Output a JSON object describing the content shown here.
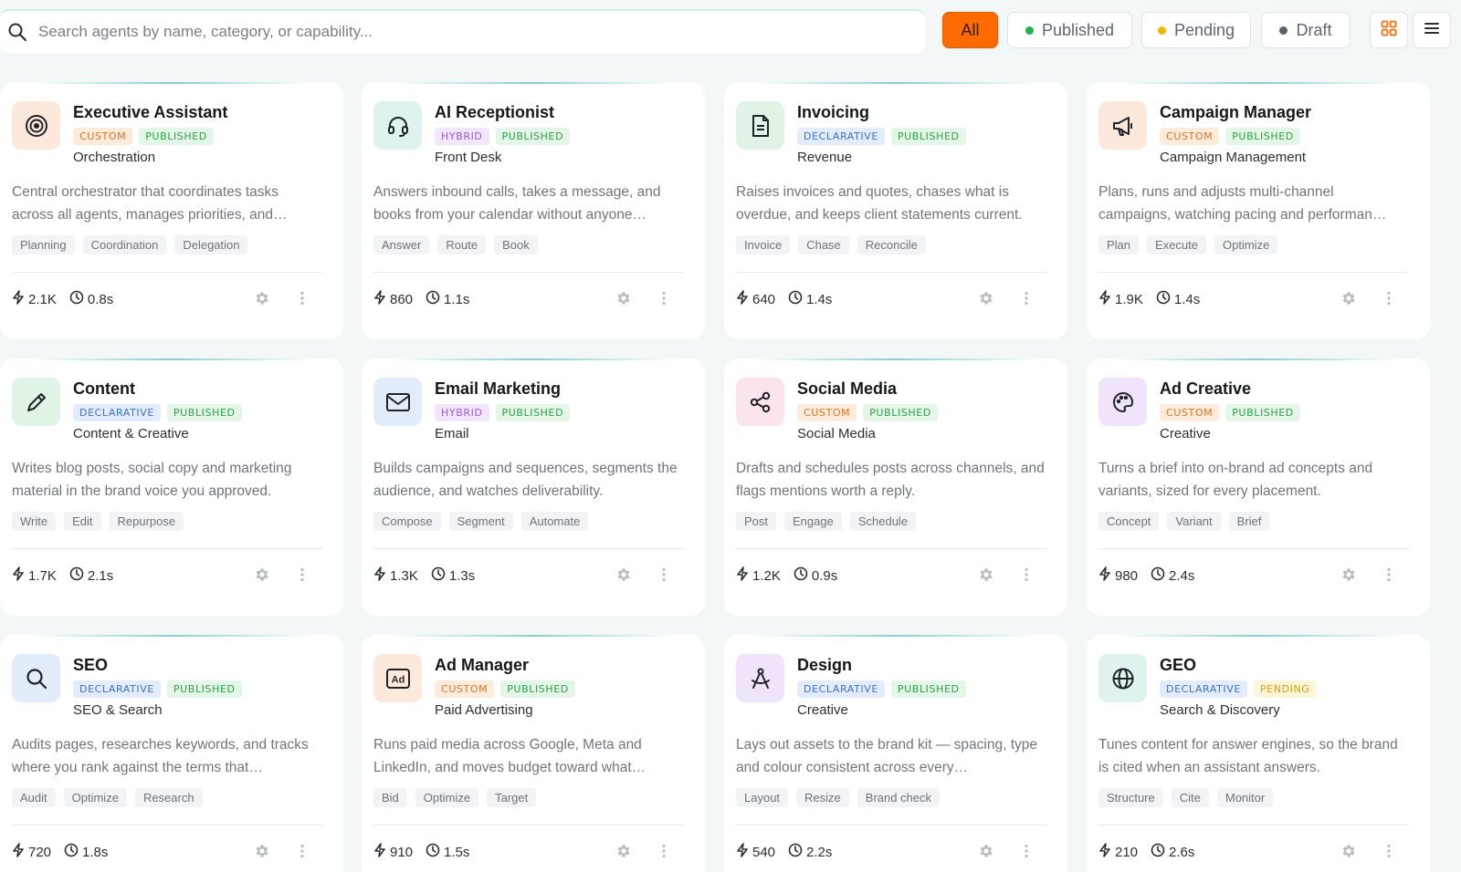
{
  "search": {
    "placeholder": "Search agents by name, category, or capability..."
  },
  "filters": [
    {
      "label": "All",
      "active": true
    },
    {
      "label": "Published",
      "dot": "#22b14c"
    },
    {
      "label": "Pending",
      "dot": "#f2b705"
    },
    {
      "label": "Draft",
      "dot": "#5b6168"
    }
  ],
  "colors": {
    "accent": "#ff6a00"
  },
  "cards": [
    {
      "title": "Executive Assistant",
      "type": "CUSTOM",
      "status": "PUBLISHED",
      "category": "Orchestration",
      "description": "Central orchestrator that coordinates tasks across all agents, manages priorities, and…",
      "tags": [
        "Planning",
        "Coordination",
        "Delegation"
      ],
      "runs": "2.1K",
      "latency": "0.8s",
      "icon": "target-icon",
      "icon_bg": "#fde9dc"
    },
    {
      "title": "AI Receptionist",
      "type": "HYBRID",
      "status": "PUBLISHED",
      "category": "Front Desk",
      "description": "Answers inbound calls, takes a message, and books from your calendar without anyone…",
      "tags": [
        "Answer",
        "Route",
        "Book"
      ],
      "runs": "860",
      "latency": "1.1s",
      "icon": "headset-icon",
      "icon_bg": "#def3f0"
    },
    {
      "title": "Invoicing",
      "type": "DECLARATIVE",
      "status": "PUBLISHED",
      "category": "Revenue",
      "description": "Raises invoices and quotes, chases what is overdue, and keeps client statements current.",
      "tags": [
        "Invoice",
        "Chase",
        "Reconcile"
      ],
      "runs": "640",
      "latency": "1.4s",
      "icon": "invoice-icon",
      "icon_bg": "#e0f3e5"
    },
    {
      "title": "Campaign Manager",
      "type": "CUSTOM",
      "status": "PUBLISHED",
      "category": "Campaign Management",
      "description": "Plans, runs and adjusts multi-channel campaigns, watching pacing and performan…",
      "tags": [
        "Plan",
        "Execute",
        "Optimize"
      ],
      "runs": "1.9K",
      "latency": "1.4s",
      "icon": "megaphone-icon",
      "icon_bg": "#fde9dc"
    },
    {
      "title": "Content",
      "type": "DECLARATIVE",
      "status": "PUBLISHED",
      "category": "Content & Creative",
      "description": "Writes blog posts, social copy and marketing material in the brand voice you approved.",
      "tags": [
        "Write",
        "Edit",
        "Repurpose"
      ],
      "runs": "1.7K",
      "latency": "2.1s",
      "icon": "pencil-icon",
      "icon_bg": "#e0f3e5"
    },
    {
      "title": "Email Marketing",
      "type": "HYBRID",
      "status": "PUBLISHED",
      "category": "Email",
      "description": "Builds campaigns and sequences, segments the audience, and watches deliverability.",
      "tags": [
        "Compose",
        "Segment",
        "Automate"
      ],
      "runs": "1.3K",
      "latency": "1.3s",
      "icon": "envelope-icon",
      "icon_bg": "#e3ecfb"
    },
    {
      "title": "Social Media",
      "type": "CUSTOM",
      "status": "PUBLISHED",
      "category": "Social Media",
      "description": "Drafts and schedules posts across channels, and flags mentions worth a reply.",
      "tags": [
        "Post",
        "Engage",
        "Schedule"
      ],
      "runs": "1.2K",
      "latency": "0.9s",
      "icon": "share-icon",
      "icon_bg": "#fce4ee"
    },
    {
      "title": "Ad Creative",
      "type": "CUSTOM",
      "status": "PUBLISHED",
      "category": "Creative",
      "description": "Turns a brief into on-brand ad concepts and variants, sized for every placement.",
      "tags": [
        "Concept",
        "Variant",
        "Brief"
      ],
      "runs": "980",
      "latency": "2.4s",
      "icon": "palette-icon",
      "icon_bg": "#efe4fb"
    },
    {
      "title": "SEO",
      "type": "DECLARATIVE",
      "status": "PUBLISHED",
      "category": "SEO & Search",
      "description": "Audits pages, researches keywords, and tracks where you rank against the terms that…",
      "tags": [
        "Audit",
        "Optimize",
        "Research"
      ],
      "runs": "720",
      "latency": "1.8s",
      "icon": "search-icon",
      "icon_bg": "#e3ecfb"
    },
    {
      "title": "Ad Manager",
      "type": "CUSTOM",
      "status": "PUBLISHED",
      "category": "Paid Advertising",
      "description": "Runs paid media across Google, Meta and LinkedIn, and moves budget toward what…",
      "tags": [
        "Bid",
        "Optimize",
        "Target"
      ],
      "runs": "910",
      "latency": "1.5s",
      "icon": "ad-icon",
      "icon_bg": "#fde9dc"
    },
    {
      "title": "Design",
      "type": "DECLARATIVE",
      "status": "PUBLISHED",
      "category": "Creative",
      "description": "Lays out assets to the brand kit — spacing, type and colour consistent across every…",
      "tags": [
        "Layout",
        "Resize",
        "Brand check"
      ],
      "runs": "540",
      "latency": "2.2s",
      "icon": "compass-icon",
      "icon_bg": "#efe4fb"
    },
    {
      "title": "GEO",
      "type": "DECLARATIVE",
      "status": "PENDING",
      "category": "Search & Discovery",
      "description": "Tunes content for answer engines, so the brand is cited when an assistant answers.",
      "tags": [
        "Structure",
        "Cite",
        "Monitor"
      ],
      "runs": "210",
      "latency": "2.6s",
      "icon": "globe-icon",
      "icon_bg": "#def3f0"
    }
  ]
}
